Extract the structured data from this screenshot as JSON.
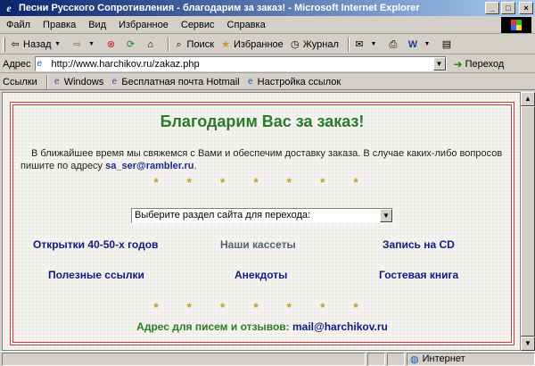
{
  "window": {
    "title": "Песни Русского Сопротивления - благодарим за заказ! - Microsoft Internet Explorer",
    "controls": {
      "minimize": "_",
      "maximize": "□",
      "close": "×"
    }
  },
  "menu": [
    "Файл",
    "Правка",
    "Вид",
    "Избранное",
    "Сервис",
    "Справка"
  ],
  "toolbar": {
    "back": "Назад",
    "search": "Поиск",
    "favorites": "Избранное",
    "history": "Журнал"
  },
  "address": {
    "label": "Адрес",
    "url": "http://www.harchikov.ru/zakaz.php",
    "go": "Переход"
  },
  "links": {
    "label": "Ссылки",
    "items": [
      "Windows",
      "Бесплатная почта Hotmail",
      "Настройка ссылок"
    ]
  },
  "page": {
    "heading": "Благодарим Вас за заказ!",
    "paragraph": "В ближайшее время мы свяжемся с Вами и обеспечим доставку заказа. В случае каких-либо вопросов пишите по адресу ",
    "email": "sa_ser@rambler.ru",
    "paragraph_end": ".",
    "stars": "* * * * * * *",
    "select_placeholder": "Выберите раздел сайта для перехода:",
    "nav": {
      "postcards": "Открытки 40-50-х годов",
      "cassettes": "Наши кассеты",
      "cd": "Запись на CD",
      "links": "Полезные ссылки",
      "jokes": "Анекдоты",
      "guestbook": "Гостевая книга"
    },
    "contact_label": "Адрес для писем и отзывов: ",
    "contact_email": "mail@harchikov.ru"
  },
  "status": {
    "zone": "Интернет"
  },
  "colors": {
    "heading": "#2a7a2a",
    "link": "#101a80",
    "stars": "#c8a020",
    "frame": "#c04040"
  }
}
